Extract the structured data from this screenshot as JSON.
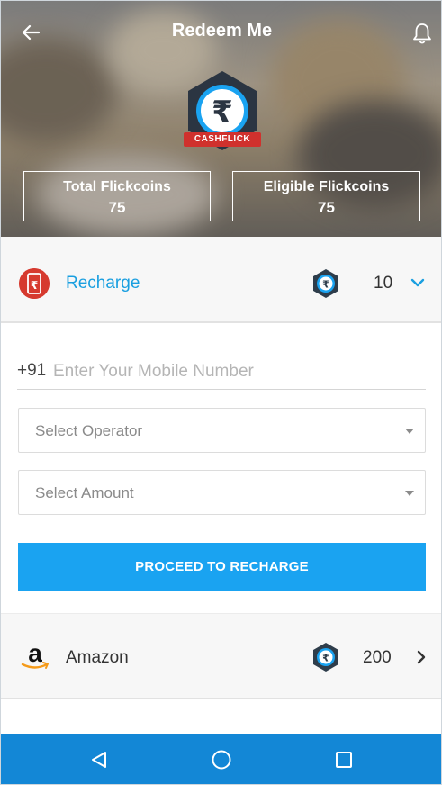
{
  "header": {
    "title": "Redeem Me",
    "logo_text": "CASHFLICK",
    "total_label": "Total Flickcoins",
    "total_value": "75",
    "eligible_label": "Eligible Flickcoins",
    "eligible_value": "75"
  },
  "recharge": {
    "label": "Recharge",
    "coins": "10",
    "expanded": true,
    "phone_prefix": "+91",
    "phone_placeholder": "Enter Your Mobile Number",
    "operator_placeholder": "Select Operator",
    "amount_placeholder": "Select Amount",
    "proceed_label": "PROCEED TO RECHARGE"
  },
  "amazon": {
    "label": "Amazon",
    "coins": "200"
  },
  "icons": {
    "back": "back-arrow-icon",
    "bell": "bell-icon",
    "coin": "rupee-coin-icon",
    "recharge": "mobile-rupee-icon",
    "expand": "chevron-down-icon",
    "open": "chevron-right-icon",
    "nav": [
      "triangle-back-icon",
      "circle-home-icon",
      "square-recents-icon"
    ]
  },
  "colors": {
    "accent": "#1aa3f1",
    "link": "#1a9fe0",
    "navbar": "#1387d6",
    "brand_red": "#d0312d",
    "badge_dark": "#2e3d4b"
  }
}
